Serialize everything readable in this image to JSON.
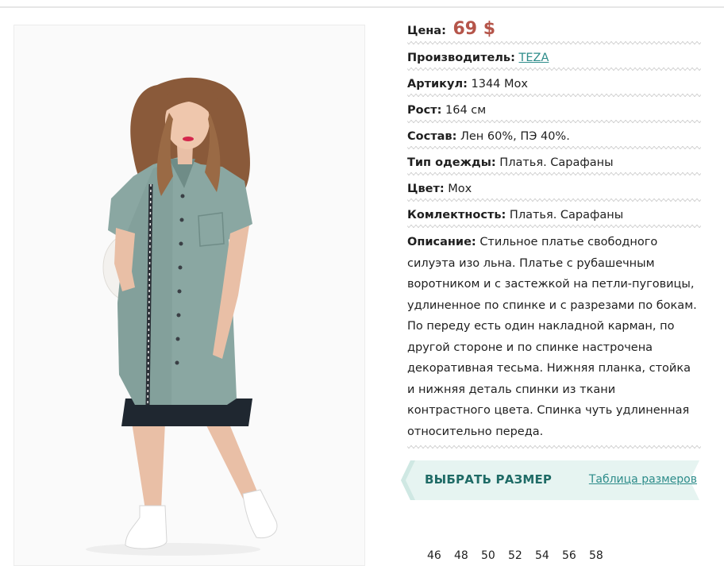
{
  "product": {
    "price_label": "Цена:",
    "price_value": "69 $",
    "brand_label": "Производитель:",
    "brand_value": "TEZA",
    "article_label": "Артикул:",
    "article_value": "1344 Мох",
    "height_label": "Рост:",
    "height_value": "164 см",
    "composition_label": "Состав:",
    "composition_value": "Лен 60%, ПЭ 40%.",
    "type_label": "Тип одежды:",
    "type_value": "Платья. Сарафаны",
    "color_label": "Цвет:",
    "color_value": "Мох",
    "set_label": "Комлектность:",
    "set_value": "Платья. Сарафаны",
    "description_label": "Описание:",
    "description_value": "Стильное платье свободного силуэта изо льна. Платье с рубашечным воротником и с застежкой на петли-пуговицы, удлиненное по спинке и с разрезами по бокам. По переду есть один накладной карман, по другой стороне и по спинке настрочена декоративная тесьма. Нижняя планка, стойка и нижняя деталь спинки из ткани контрастного цвета. Спинка чуть удлиненная относительно переда."
  },
  "size_bar": {
    "choose_label": "ВЫБРАТЬ РАЗМЕР",
    "table_link": "Таблица размеров"
  },
  "sizes": [
    "46",
    "48",
    "50",
    "52",
    "54",
    "56",
    "58"
  ],
  "colors": {
    "price": "#b5554a",
    "accent": "#2d8c8a",
    "bar_bg": "#e6f4f1",
    "dress": "#8aa7a2"
  }
}
